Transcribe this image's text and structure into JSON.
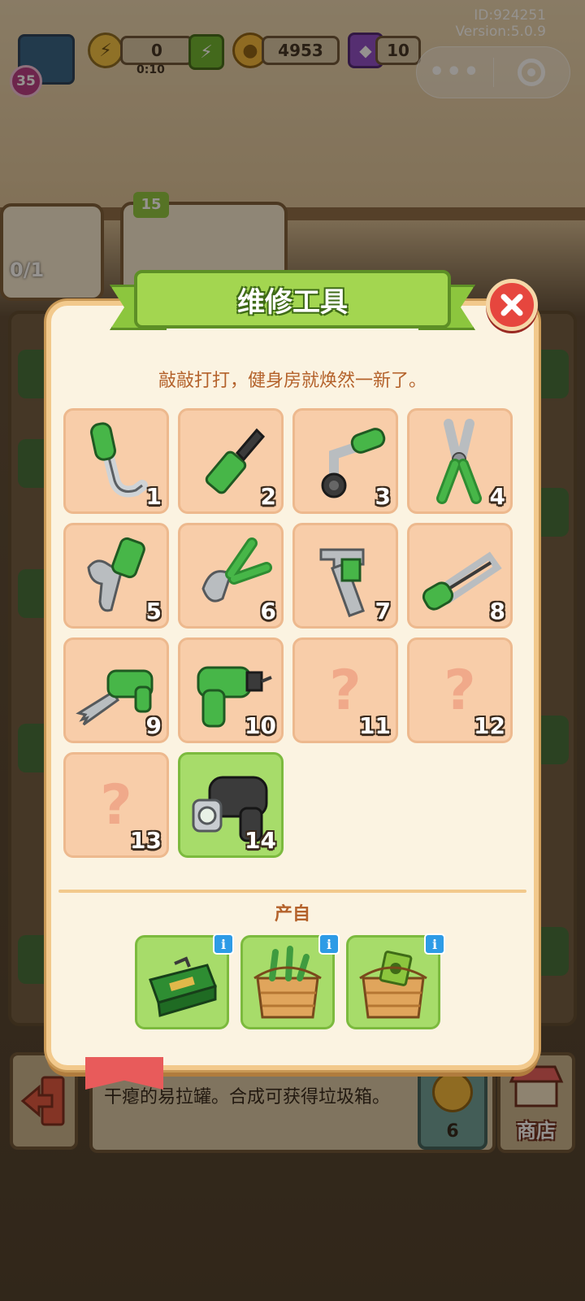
{
  "system": {
    "user_id": "ID:924251",
    "version": "Version:5.0.9"
  },
  "hud": {
    "level": "35",
    "energy_value": "0",
    "energy_timer": "0:10",
    "coins": "4953",
    "gems": "10",
    "background_badge": "15",
    "background_counter": "0/1"
  },
  "capsule": {
    "more_icon": "more-dots-icon",
    "close_icon": "target-ring-icon"
  },
  "modal": {
    "title": "维修工具",
    "description": "敲敲打打，健身房就焕然一新了。",
    "close_icon": "close-x-icon",
    "unknown_glyph": "?",
    "tools": [
      {
        "number": "1",
        "icon": "curved-pipe-tool-icon",
        "unlocked": true,
        "selected": false
      },
      {
        "number": "2",
        "icon": "screwdriver-icon",
        "unlocked": true,
        "selected": false
      },
      {
        "number": "3",
        "icon": "socket-wrench-icon",
        "unlocked": true,
        "selected": false
      },
      {
        "number": "4",
        "icon": "pliers-icon",
        "unlocked": true,
        "selected": false
      },
      {
        "number": "5",
        "icon": "adjustable-wrench-icon",
        "unlocked": true,
        "selected": false
      },
      {
        "number": "6",
        "icon": "wire-cutter-icon",
        "unlocked": true,
        "selected": false
      },
      {
        "number": "7",
        "icon": "pipe-wrench-icon",
        "unlocked": true,
        "selected": false
      },
      {
        "number": "8",
        "icon": "hacksaw-icon",
        "unlocked": true,
        "selected": false
      },
      {
        "number": "9",
        "icon": "reciprocating-saw-icon",
        "unlocked": true,
        "selected": false
      },
      {
        "number": "10",
        "icon": "power-drill-icon",
        "unlocked": true,
        "selected": false
      },
      {
        "number": "11",
        "icon": "unknown-tool-icon",
        "unlocked": false,
        "selected": false
      },
      {
        "number": "12",
        "icon": "unknown-tool-icon",
        "unlocked": false,
        "selected": false
      },
      {
        "number": "13",
        "icon": "unknown-tool-icon",
        "unlocked": false,
        "selected": false
      },
      {
        "number": "14",
        "icon": "impact-driver-icon",
        "unlocked": true,
        "selected": true
      }
    ],
    "source_label": "产自",
    "sources": [
      {
        "icon": "green-toolbox-icon",
        "info": "i"
      },
      {
        "icon": "wooden-tool-crate-icon",
        "info": "i"
      },
      {
        "icon": "wooden-money-crate-icon",
        "info": "i"
      }
    ]
  },
  "bottom": {
    "description": "干瘪的易拉罐。合成可获得垃圾箱。",
    "cost": "6",
    "shop_label": "商店",
    "exit_icon": "exit-door-icon"
  },
  "colors": {
    "accent_green": "#a3d650",
    "slot_peach": "#f8cda9",
    "close_red": "#e6463e",
    "text_orange": "#b4622b"
  }
}
